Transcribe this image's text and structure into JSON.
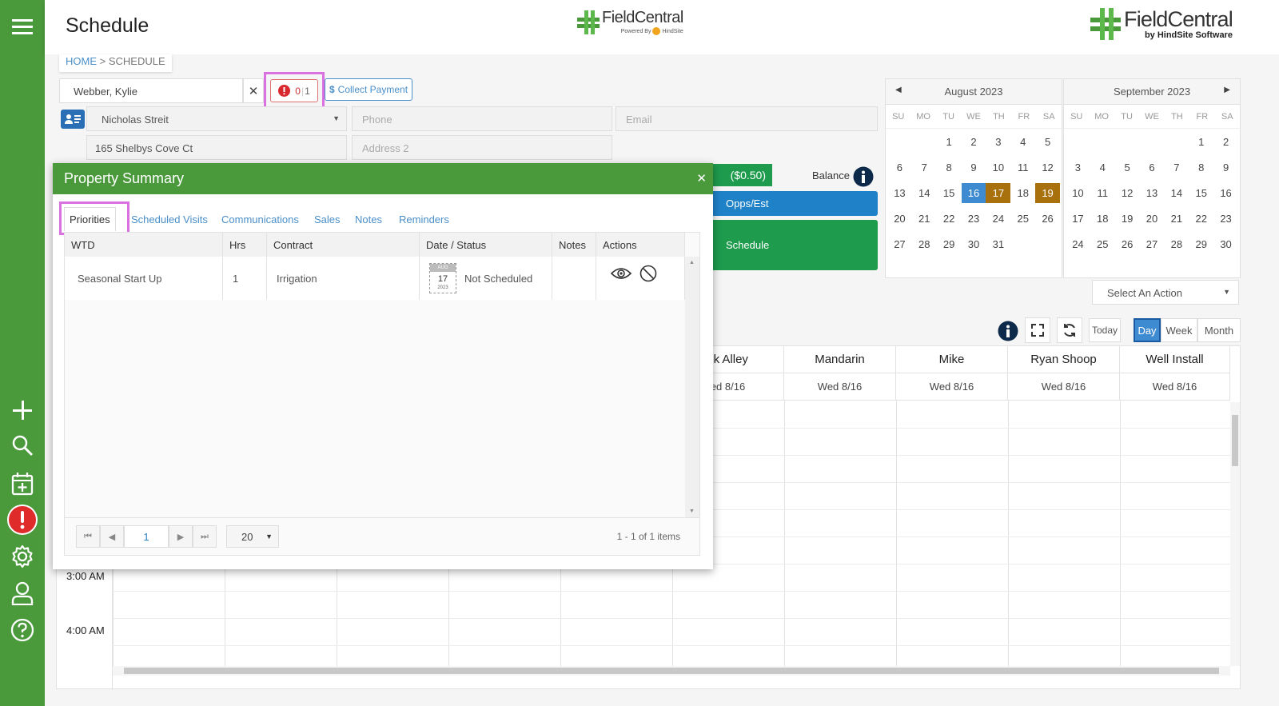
{
  "header": {
    "title": "Schedule",
    "logo_center": {
      "name": "FieldCentral",
      "sub": "Powered By",
      "sub_brand": "HindSite"
    },
    "logo_right": {
      "name": "FieldCentral",
      "sub": "by HindSite Software"
    }
  },
  "breadcrumb": {
    "home": "HOME",
    "sep": ">",
    "current": "SCHEDULE"
  },
  "customer": {
    "name": "Webber, Kylie",
    "alerts": "0",
    "alerts_total": "1",
    "collect_payment": "Collect Payment",
    "contact": "Nicholas Streit",
    "phone_placeholder": "Phone",
    "email_placeholder": "Email",
    "address1": "165 Shelbys Cove Ct",
    "address2_placeholder": "Address 2"
  },
  "balance": {
    "amount": "($0.50)",
    "label": "Balance"
  },
  "actions": {
    "opps": "Opps/Est",
    "schedule": "Schedule",
    "select_action": "Select An Action"
  },
  "calendars": [
    {
      "title": "August 2023",
      "days": [
        "SU",
        "MO",
        "TU",
        "WE",
        "TH",
        "FR",
        "SA"
      ],
      "offset": 2,
      "count": 31,
      "today": 16,
      "marked": [
        17,
        19
      ]
    },
    {
      "title": "September 2023",
      "days": [
        "SU",
        "MO",
        "TU",
        "WE",
        "TH",
        "FR",
        "SA"
      ],
      "offset": 5,
      "count": 30,
      "today": null,
      "marked": []
    }
  ],
  "toolbar": {
    "today": "Today",
    "day": "Day",
    "week": "Week",
    "month": "Month"
  },
  "schedule_cols": [
    {
      "name": "ck Alley",
      "date": "ed 8/16"
    },
    {
      "name": "Mandarin",
      "date": "Wed 8/16"
    },
    {
      "name": "Mike",
      "date": "Wed 8/16"
    },
    {
      "name": "Ryan Shoop",
      "date": "Wed 8/16"
    },
    {
      "name": "Well Install",
      "date": "Wed 8/16"
    }
  ],
  "times": [
    "3:00 AM",
    "4:00 AM"
  ],
  "modal": {
    "title": "Property Summary",
    "tabs": [
      "Priorities",
      "Scheduled Visits",
      "Communications",
      "Sales",
      "Notes",
      "Reminders"
    ],
    "columns": [
      "WTD",
      "Hrs",
      "Contract",
      "Date / Status",
      "Notes",
      "Actions"
    ],
    "rows": [
      {
        "wtd": "Seasonal Start Up",
        "hrs": "1",
        "contract": "Irrigation",
        "cal_month": "AUG",
        "cal_day": "17",
        "cal_year": "2023",
        "status": "Not Scheduled",
        "notes": ""
      }
    ],
    "pager": {
      "page": "1",
      "size": "20",
      "info": "1 - 1 of 1 items"
    }
  },
  "colors": {
    "green": "#4a9a3c",
    "blue": "#3f8bd1",
    "gold": "#a8710d",
    "highlight": "#d972e0"
  }
}
